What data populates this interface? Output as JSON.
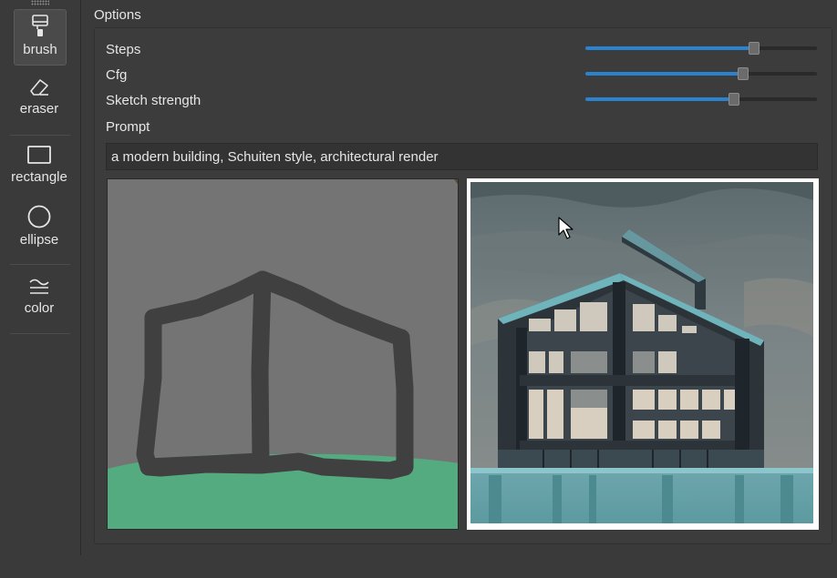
{
  "tools": [
    {
      "id": "brush",
      "label": "brush",
      "icon": "paint-roller-icon",
      "active": true
    },
    {
      "id": "eraser",
      "label": "eraser",
      "icon": "eraser-icon",
      "active": false
    },
    {
      "id": "rectangle",
      "label": "rectangle",
      "icon": "rectangle-icon",
      "active": false
    },
    {
      "id": "ellipse",
      "label": "ellipse",
      "icon": "ellipse-icon",
      "active": false
    },
    {
      "id": "color",
      "label": "color",
      "icon": "color-lines-icon",
      "active": false
    }
  ],
  "options": {
    "title": "Options",
    "params": [
      {
        "label": "Steps",
        "value_fraction": 0.73
      },
      {
        "label": "Cfg",
        "value_fraction": 0.68
      },
      {
        "label": "Sketch strength",
        "value_fraction": 0.64
      }
    ],
    "prompt_label": "Prompt",
    "prompt_value": "a modern building, Schuiten style, architectural render"
  },
  "colors": {
    "accent": "#2b83cf",
    "background": "#3a3a3a",
    "sketch_canvas": "#747474",
    "sketch_grass": "#55ab80",
    "sketch_stroke": "#404040"
  }
}
